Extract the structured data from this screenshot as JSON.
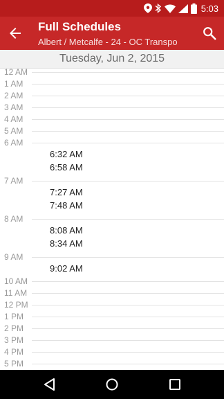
{
  "status_bar": {
    "time": "5:03",
    "icons": [
      "location-icon",
      "bluetooth-icon",
      "wifi-icon",
      "signal-icon",
      "battery-icon"
    ]
  },
  "app_bar": {
    "title": "Full Schedules",
    "subtitle": "Albert / Metcalfe - 24 - OC Transpo",
    "back_icon": "arrow-back-icon",
    "search_icon": "search-icon"
  },
  "date_header": "Tuesday, Jun 2, 2015",
  "hours": [
    "12 AM",
    "1 AM",
    "2 AM",
    "3 AM",
    "4 AM",
    "5 AM",
    "6 AM",
    "7 AM",
    "8 AM",
    "9 AM",
    "10 AM",
    "11 AM",
    "12 PM",
    "1 PM",
    "2 PM",
    "3 PM",
    "4 PM",
    "5 PM"
  ],
  "trips": [
    "6:32 AM",
    "6:58 AM",
    "7:27 AM",
    "7:48 AM",
    "8:08 AM",
    "8:34 AM",
    "9:02 AM"
  ],
  "colors": {
    "status_bar": "#b71c1c",
    "app_bar": "#c62828"
  },
  "nav_bar": {
    "icons": [
      "back-triangle-icon",
      "home-circle-icon",
      "recents-square-icon"
    ]
  }
}
